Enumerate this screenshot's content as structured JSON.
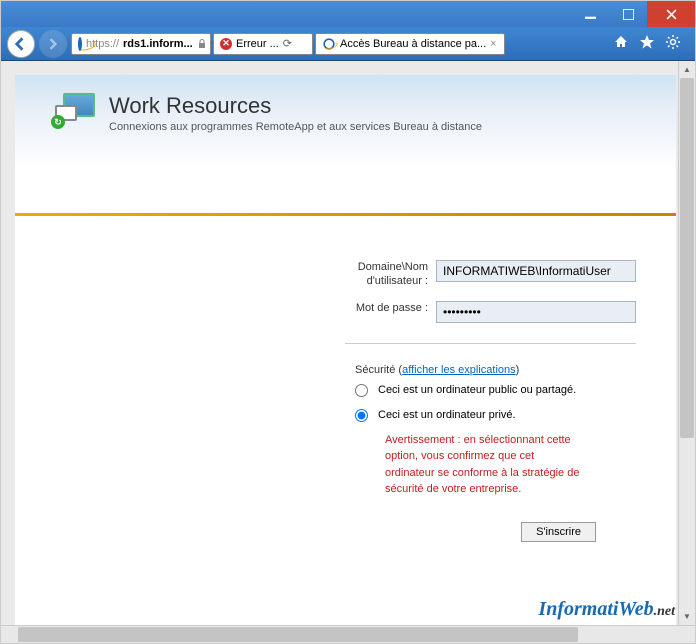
{
  "window": {
    "minimize": "minimize",
    "maximize": "maximize",
    "close": "close"
  },
  "browser": {
    "url_prefix": "https://",
    "url_host": "rds1.inform...",
    "tab1_label": "Erreur ...",
    "tab2_label": "Accès Bureau à distance pa...",
    "refresh_glyph": "⟳",
    "dropdown_glyph": "▾",
    "tab_close": "×"
  },
  "page": {
    "title": "Work Resources",
    "subtitle": "Connexions aux programmes RemoteApp et aux services Bureau à distance"
  },
  "form": {
    "username_label": "Domaine\\Nom d'utilisateur :",
    "username_value": "INFORMATIWEB\\InformatiUser",
    "password_label": "Mot de passe :",
    "password_value": "•••••••••",
    "security_label": "Sécurité",
    "security_link": "afficher les explications",
    "radio_public": "Ceci est un ordinateur public ou partagé.",
    "radio_private": "Ceci est un ordinateur privé.",
    "warning": "Avertissement : en sélectionnant cette option, vous confirmez que cet ordinateur se conforme à la stratégie de sécurité de votre entreprise.",
    "submit": "S'inscrire"
  },
  "watermark": {
    "main": "InformatiWeb",
    "suffix": ".net"
  }
}
